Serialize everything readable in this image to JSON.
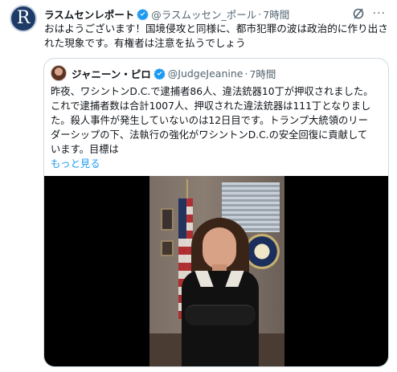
{
  "post": {
    "author_name": "ラスムセンレポート",
    "avatar_letter": "R",
    "handle": "@ラスムッセン_ポール",
    "separator": "·",
    "time": "7時間",
    "more_glyph": "···",
    "text_line1": "おはようございます！国境侵攻と同様に、都市犯罪の波は政治的に作り出さ",
    "text_line2": "れた現象です。有権者は注意を払うでしょう"
  },
  "quote": {
    "author_name": "ジャニーン・ピロ",
    "handle": "@JudgeJeanine",
    "separator": "·",
    "time": "7時間",
    "lines": [
      "昨夜、ワシントンD.C.で逮捕者86人、違法銃器10丁が押収されました。",
      "これで逮捕者数は合計1007人、押収された違法銃器は111丁となりまし",
      "た。殺人事件が発生していないのは12日目です。トランプ大統領のリー",
      "ダーシップの下、法執行の強化がワシントンD.C.の安全回復に貢献して",
      "います。目標は"
    ],
    "show_more": "もっと見る"
  },
  "colors": {
    "verified_badge": "#1d9bf0",
    "link": "#1d9bf0",
    "muted": "#536471",
    "border": "#cfd9de"
  },
  "icons": {
    "verified": "verified-badge-icon",
    "grok": "grok-icon",
    "more": "more-options-icon"
  }
}
